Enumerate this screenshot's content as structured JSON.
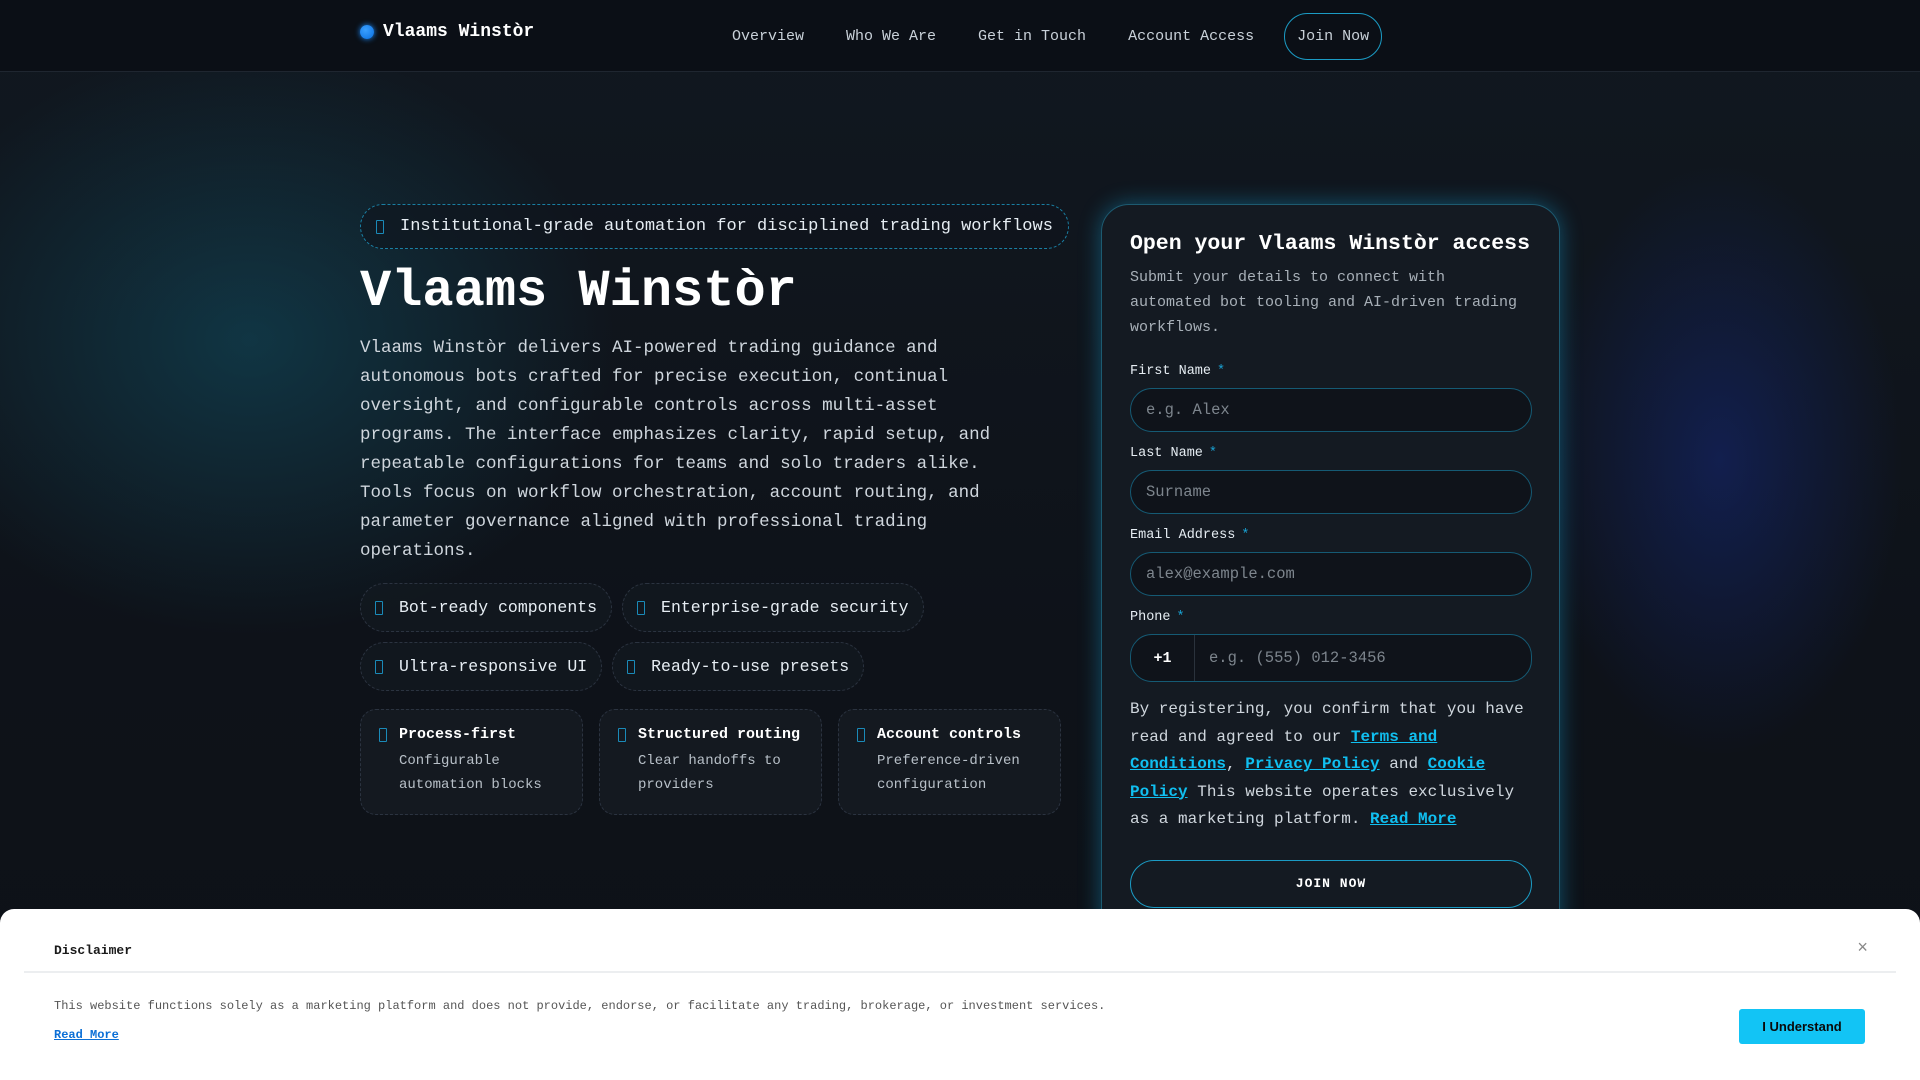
{
  "nav": {
    "brand": "Vlaams Winstòr",
    "links": [
      "Overview",
      "Who We Are",
      "Get in Touch",
      "Account Access"
    ],
    "cta": "Join Now"
  },
  "hero": {
    "badge": "Institutional-grade automation for disciplined trading workflows",
    "title": "Vlaams Winstòr",
    "lead": "Vlaams Winstòr delivers AI-powered trading guidance and autonomous bots crafted for precise execution, continual oversight, and configurable controls across multi-asset programs. The interface emphasizes clarity, rapid setup, and repeatable configurations for teams and solo traders alike. Tools focus on workflow orchestration, account routing, and parameter governance aligned with professional trading operations.",
    "pills": [
      "Bot-ready components",
      "Enterprise-grade security",
      "Ultra-responsive UI",
      "Ready-to-use presets"
    ],
    "cards": [
      {
        "title": "Process-first",
        "desc": "Configurable automation blocks"
      },
      {
        "title": "Structured routing",
        "desc": "Clear handoffs to providers"
      },
      {
        "title": "Account controls",
        "desc": "Preference-driven configuration"
      }
    ]
  },
  "form": {
    "title": "Open your Vlaams Winstòr access",
    "subtitle": "Submit your details to connect with automated bot tooling and AI-driven trading workflows.",
    "first_name": {
      "label": "First Name",
      "placeholder": "e.g. Alex"
    },
    "last_name": {
      "label": "Last Name",
      "placeholder": "Surname"
    },
    "email": {
      "label": "Email Address",
      "placeholder": "alex@example.com"
    },
    "phone": {
      "label": "Phone",
      "code": "+1",
      "placeholder": "e.g. (555) 012-3456"
    },
    "required_mark": "*",
    "consent": {
      "t1": "By registering, you confirm that you have read and agreed to our ",
      "terms": "Terms and Conditions",
      "t2": ", ",
      "privacy": "Privacy Policy",
      "t3": " and ",
      "cookie": "Cookie Policy",
      "t4": " This website operates exclusively as a marketing platform. ",
      "read_more": "Read More"
    },
    "submit": "JOIN NOW"
  },
  "disclaimer": {
    "title": "Disclaimer",
    "close": "×",
    "text": "This website functions solely as a marketing platform and does not provide, endorse, or facilitate any trading, brokerage, or investment services.",
    "read_more": "Read More",
    "button": "I Understand"
  }
}
